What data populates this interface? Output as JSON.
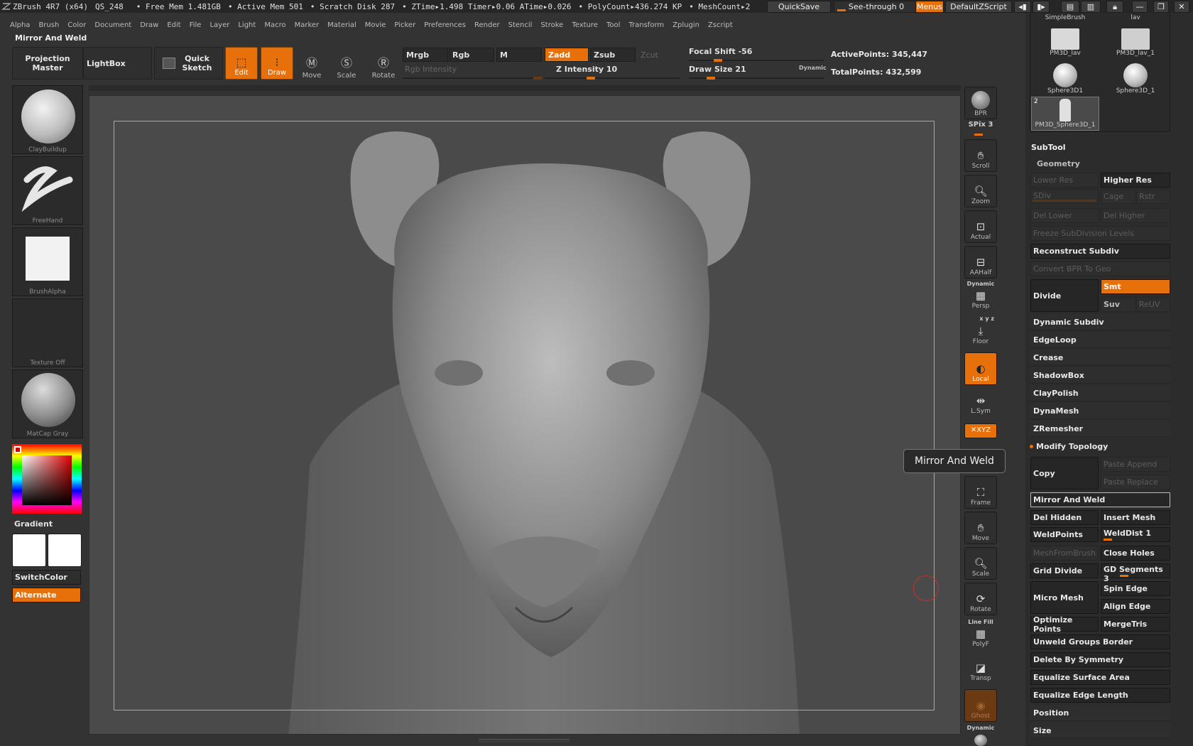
{
  "status": {
    "app_title": "ZBrush 4R7 (x64)",
    "qs": "QS_248",
    "free_mem": "• Free Mem 1.481GB",
    "active_mem": "• Active Mem 501",
    "scratch_disk": "• Scratch Disk 287",
    "ztime": "• ZTime▸1.498 Timer▸0.06 ATime▸0.026",
    "polycount": "• PolyCount▸436.274 KP",
    "meshcount": "• MeshCount▸2",
    "quicksave": "QuickSave",
    "see_through": "See-through 0",
    "menus": "Menus",
    "default_zscript": "DefaultZScript"
  },
  "menus": [
    "Alpha",
    "Brush",
    "Color",
    "Document",
    "Draw",
    "Edit",
    "File",
    "Layer",
    "Light",
    "Macro",
    "Marker",
    "Material",
    "Movie",
    "Picker",
    "Preferences",
    "Render",
    "Stencil",
    "Stroke",
    "Texture",
    "Tool",
    "Transform",
    "Zplugin",
    "Zscript"
  ],
  "mode_title": "Mirror And Weld",
  "toolbar": {
    "projection_master": "Projection Master",
    "lightbox": "LightBox",
    "quick_sketch": "Quick Sketch",
    "edit": "Edit",
    "draw": "Draw",
    "move": "Move",
    "scale": "Scale",
    "rotate": "Rotate",
    "mrgb": "Mrgb",
    "rgb": "Rgb",
    "m": "M",
    "zadd": "Zadd",
    "zsub": "Zsub",
    "zcut": "Zcut",
    "rgb_intensity": "Rgb Intensity",
    "z_intensity": "Z Intensity 10",
    "focal_shift": "Focal Shift -56",
    "draw_size": "Draw Size 21",
    "dynamic": "Dynamic",
    "active_points": "ActivePoints: 345,447",
    "total_points": "TotalPoints: 432,599",
    "focal_shift_value": -56,
    "draw_size_value": 21,
    "z_intensity_value": 10
  },
  "left_shelf": {
    "brush": "ClayBuildup",
    "stroke": "FreeHand",
    "alpha": "BrushAlpha",
    "texture": "Texture Off",
    "material": "MatCap Gray",
    "gradient": "Gradient",
    "switch_color": "SwitchColor",
    "alternate": "Alternate"
  },
  "dock": {
    "bpr": "BPR",
    "spix": "SPix 3",
    "scroll": "Scroll",
    "zoom": "Zoom",
    "actual": "Actual",
    "aahalf": "AAHalf",
    "dynamic_label": "Dynamic",
    "persp": "Persp",
    "xyz_small": "x y z",
    "floor": "Floor",
    "local": "Local",
    "lsym": "L.Sym",
    "xyz": "✕XYZ",
    "frame": "Frame",
    "move": "Move",
    "scale": "Scale",
    "rotate": "Rotate",
    "line_fill": "Line Fill",
    "polyf": "PolyF",
    "transp": "Transp",
    "ghost": "Ghost",
    "dynamic2": "Dynamic"
  },
  "tooltip": "Mirror And Weld",
  "subtool_thumbs": [
    {
      "label": "SimpleBrush"
    },
    {
      "label": "lav"
    },
    {
      "label": "PM3D_lav"
    },
    {
      "label": "PM3D_lav_1"
    },
    {
      "label": "Sphere3D1"
    },
    {
      "label": "Sphere3D_1"
    },
    {
      "label": "PM3D_Sphere3D_1",
      "count": "2"
    }
  ],
  "rpanel": {
    "subtool": "SubTool",
    "geometry": "Geometry",
    "lower_res": "Lower Res",
    "higher_res": "Higher Res",
    "sdiv": "SDiv",
    "cage": "Cage",
    "rstr": "Rstr",
    "del_lower": "Del Lower",
    "del_higher": "Del Higher",
    "freeze_subdiv": "Freeze SubDivision Levels",
    "reconstruct_subdiv": "Reconstruct Subdiv",
    "convert_bpr": "Convert BPR To Geo",
    "divide": "Divide",
    "smt": "Smt",
    "suv": "Suv",
    "reuv": "ReUV",
    "dynamic_subdiv": "Dynamic Subdiv",
    "edgeloop": "EdgeLoop",
    "crease": "Crease",
    "shadowbox": "ShadowBox",
    "claypolish": "ClayPolish",
    "dynamesh": "DynaMesh",
    "zremesher": "ZRemesher",
    "modify_topology": "Modify Topology",
    "copy": "Copy",
    "paste_append": "Paste Append",
    "paste_replace": "Paste Replace",
    "mirror_and_weld": "Mirror And Weld",
    "del_hidden": "Del Hidden",
    "insert_mesh": "Insert Mesh",
    "weldpoints": "WeldPoints",
    "welddist": "WeldDist 1",
    "meshfrombrush": "MeshFromBrush",
    "close_holes": "Close Holes",
    "grid_divide": "Grid Divide",
    "gd_segments": "GD Segments 3",
    "micro_mesh": "Micro Mesh",
    "spin_edge": "Spin Edge",
    "align_edge": "Align Edge",
    "optimize_points": "Optimize Points",
    "mergetris": "MergeTris",
    "unweld_groups_border": "Unweld Groups Border",
    "delete_by_symmetry": "Delete By Symmetry",
    "equalize_surface_area": "Equalize Surface Area",
    "equalize_edge_length": "Equalize Edge Length",
    "position": "Position",
    "size": "Size"
  },
  "colors": {
    "accent": "#e8700a",
    "background": "#333333",
    "panel": "#2c2c2c"
  }
}
